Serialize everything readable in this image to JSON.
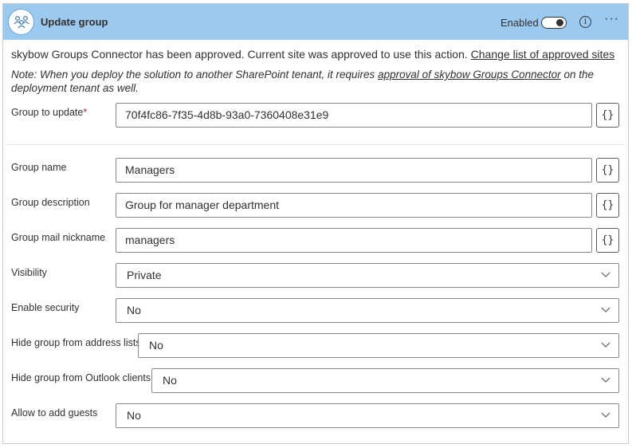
{
  "header": {
    "title": "Update group",
    "enabled_label": "Enabled",
    "enabled": true
  },
  "messages": {
    "approved_text": "skybow Groups Connector has been approved. Current site was approved to use this action.",
    "approved_link": "Change list of approved sites",
    "note_text": "Note: When you deploy the solution to another SharePoint tenant, it requires",
    "note_link": "approval of skybow Groups Connector",
    "note_suffix": "on the deployment tenant as well."
  },
  "fields": {
    "group_to_update": {
      "label": "Group to update",
      "required_mark": "*",
      "value": "70f4fc86-7f35-4d8b-93a0-7360408e31e9"
    },
    "group_name": {
      "label": "Group name",
      "value": "Managers"
    },
    "group_description": {
      "label": "Group description",
      "value": "Group for manager department"
    },
    "group_mail_nickname": {
      "label": "Group mail nickname",
      "value": "managers"
    },
    "visibility": {
      "label": "Visibility",
      "value": "Private"
    },
    "enable_security": {
      "label": "Enable security",
      "value": "No"
    },
    "hide_from_address_lists": {
      "label": "Hide group from address lists",
      "value": "No"
    },
    "hide_from_outlook": {
      "label": "Hide group from Outlook clients",
      "value": "No"
    },
    "allow_guests": {
      "label": "Allow to add guests",
      "value": "No"
    }
  },
  "expression_button_label": "{}",
  "icons": {
    "header": "group-icon",
    "info": "info-icon",
    "more": "more-icon",
    "dropdown": "chevron-down-icon"
  },
  "colors": {
    "header_bg": "#9cc9ee",
    "required": "#a4262c"
  }
}
